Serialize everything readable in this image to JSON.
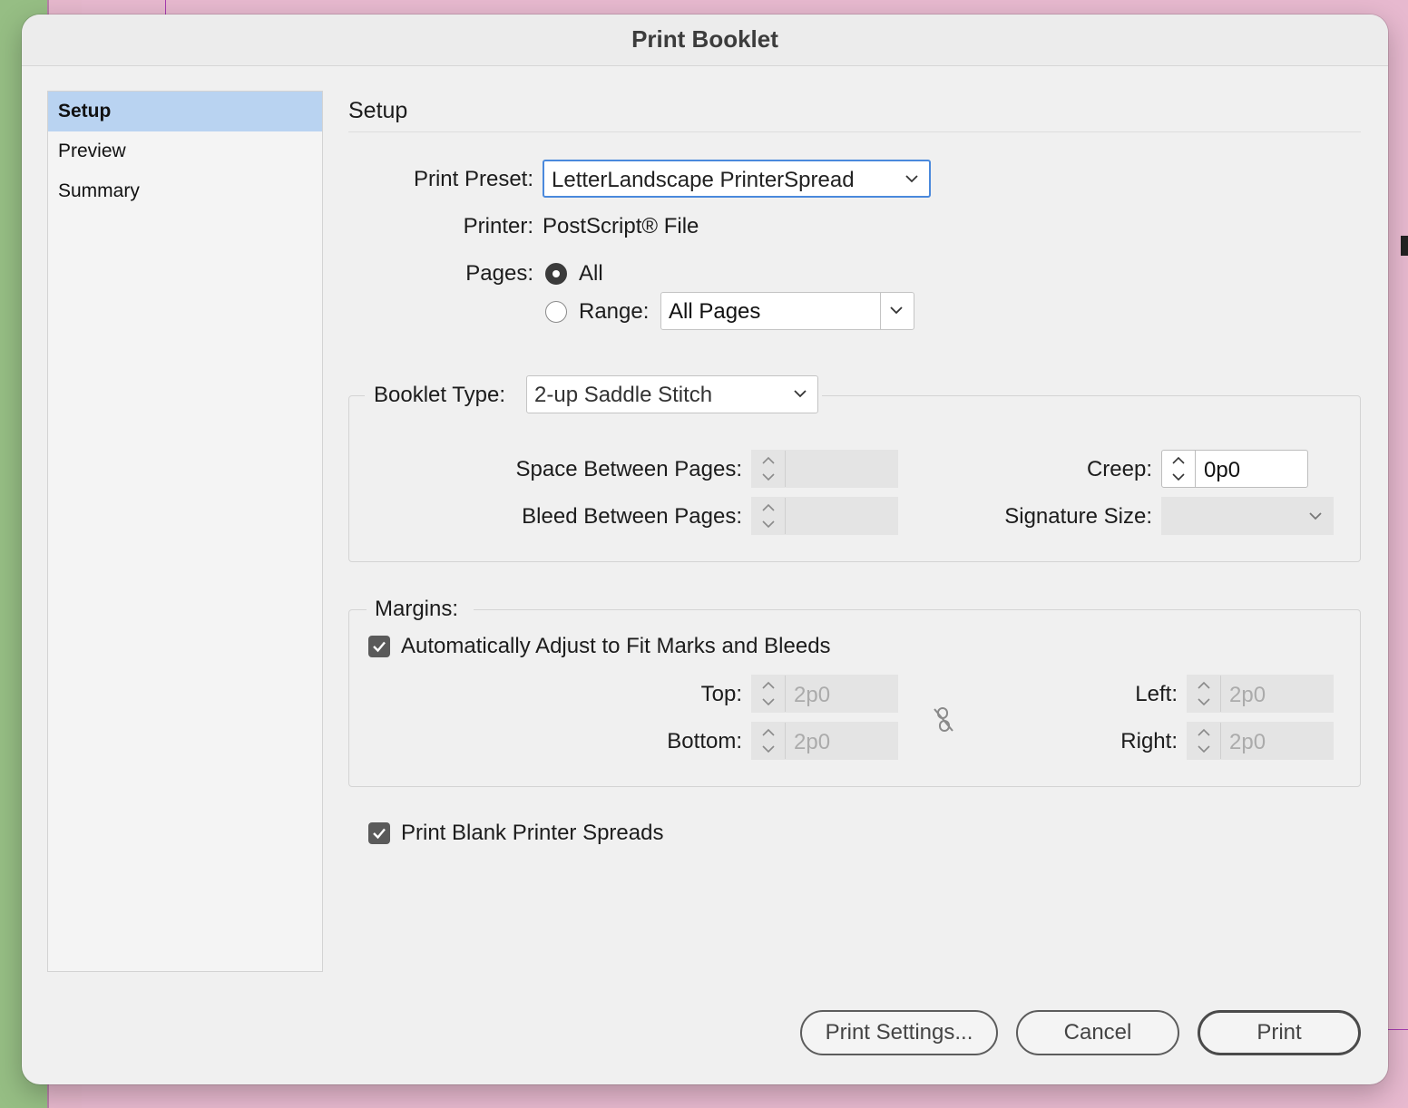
{
  "dialog": {
    "title": "Print Booklet"
  },
  "sidebar": {
    "items": [
      {
        "label": "Setup",
        "selected": true
      },
      {
        "label": "Preview",
        "selected": false
      },
      {
        "label": "Summary",
        "selected": false
      }
    ]
  },
  "setup": {
    "section_title": "Setup",
    "print_preset_label": "Print Preset:",
    "print_preset_value": "LetterLandscape PrinterSpread",
    "printer_label": "Printer:",
    "printer_value": "PostScript® File",
    "pages_label": "Pages:",
    "pages_all_label": "All",
    "pages_all_selected": true,
    "pages_range_label": "Range:",
    "pages_range_value": "All Pages"
  },
  "booklet": {
    "type_label": "Booklet Type:",
    "type_value": "2-up Saddle Stitch",
    "space_between_label": "Space Between Pages:",
    "space_between_value": "",
    "bleed_between_label": "Bleed Between Pages:",
    "bleed_between_value": "",
    "creep_label": "Creep:",
    "creep_value": "0p0",
    "signature_size_label": "Signature Size:",
    "signature_size_value": ""
  },
  "margins": {
    "label": "Margins:",
    "auto_adjust_label": "Automatically Adjust to Fit Marks and Bleeds",
    "auto_adjust_checked": true,
    "top_label": "Top:",
    "top_value": "2p0",
    "bottom_label": "Bottom:",
    "bottom_value": "2p0",
    "left_label": "Left:",
    "left_value": "2p0",
    "right_label": "Right:",
    "right_value": "2p0",
    "link_icon": "broken-chain-icon"
  },
  "print_blank": {
    "label": "Print Blank Printer Spreads",
    "checked": true
  },
  "buttons": {
    "print_settings": "Print Settings...",
    "cancel": "Cancel",
    "print": "Print"
  },
  "colors": {
    "selection": "#b9d3f1",
    "focus_ring": "#4a89dc",
    "dialog_bg": "#f0f0f0"
  }
}
